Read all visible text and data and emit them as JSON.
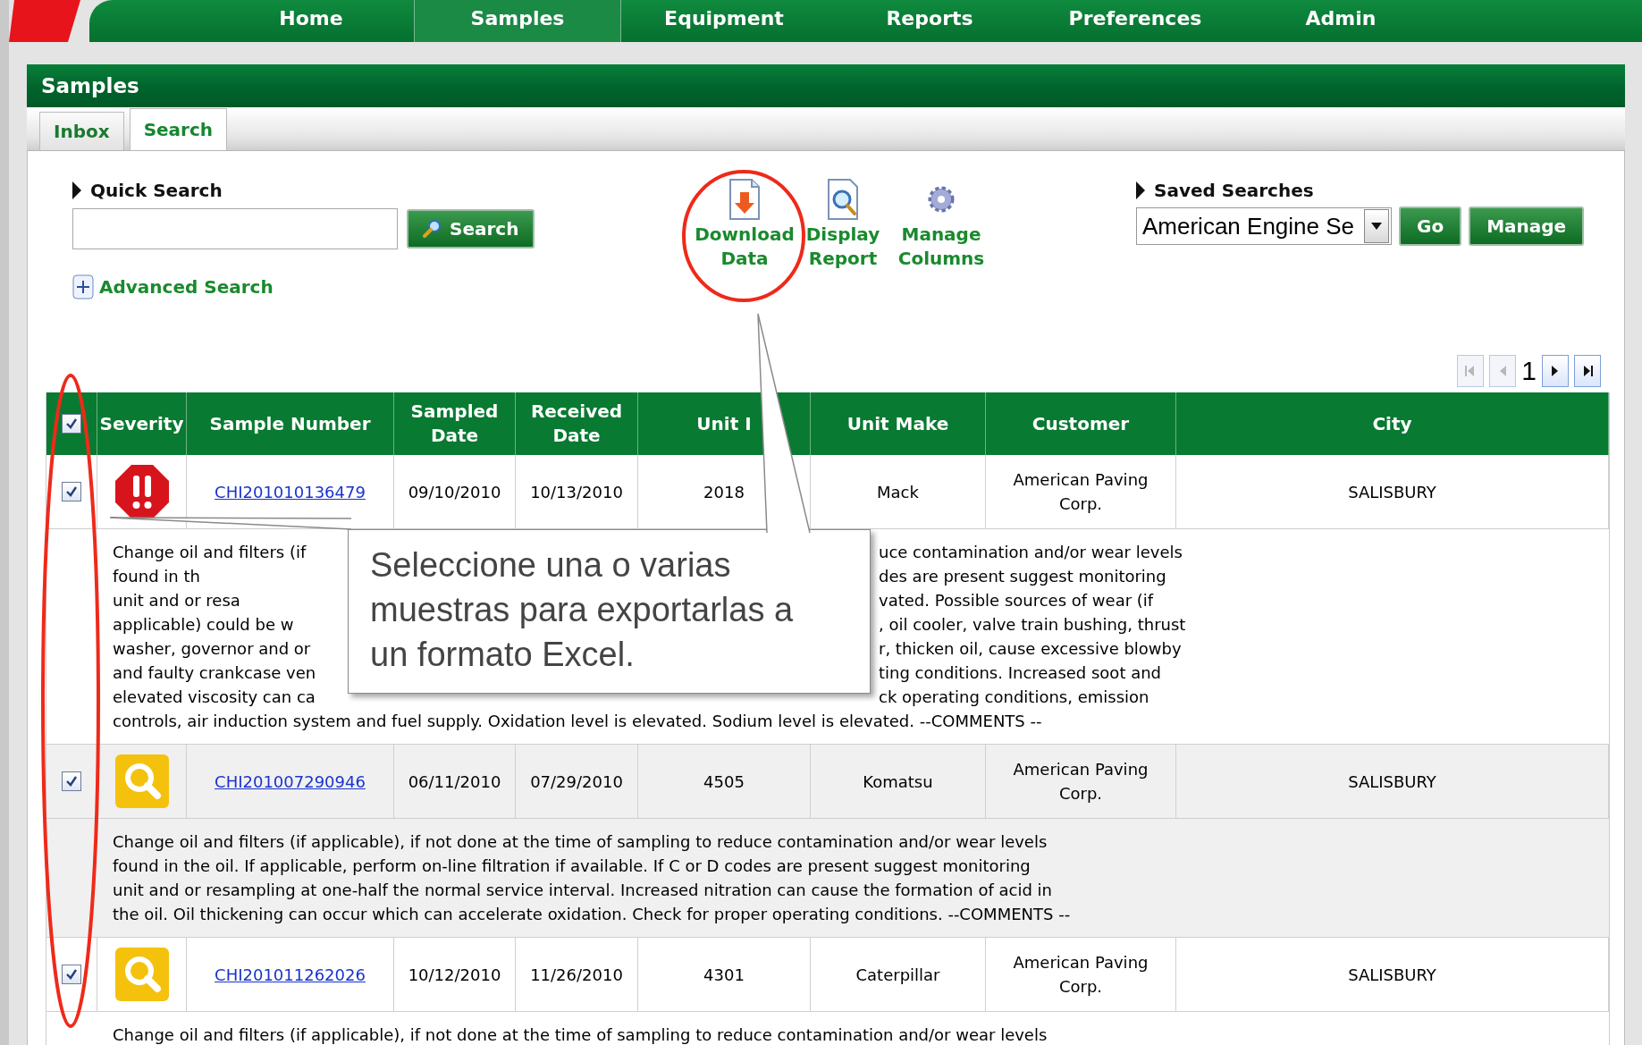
{
  "nav": [
    {
      "label": "Home",
      "selected": false
    },
    {
      "label": "Samples",
      "selected": true
    },
    {
      "label": "Equipment",
      "selected": false
    },
    {
      "label": "Reports",
      "selected": false
    },
    {
      "label": "Preferences",
      "selected": false
    },
    {
      "label": "Admin",
      "selected": false
    }
  ],
  "panel": {
    "title": "Samples"
  },
  "tabs": [
    {
      "label": "Inbox",
      "selected": false
    },
    {
      "label": "Search",
      "selected": true
    }
  ],
  "quick_search": {
    "label": "Quick Search",
    "button": "Search",
    "advanced": "Advanced Search"
  },
  "toolbar": [
    {
      "kind": "download",
      "lines": [
        "Download",
        "Data"
      ]
    },
    {
      "kind": "report",
      "lines": [
        "Display",
        "Report"
      ]
    },
    {
      "kind": "columns",
      "lines": [
        "Manage",
        "Columns"
      ]
    }
  ],
  "saved_searches": {
    "label": "Saved Searches",
    "value": "American Engine Se",
    "buttons": [
      "Go",
      "Manage"
    ]
  },
  "pager": {
    "page": "1",
    "buttons": [
      {
        "kind": "first",
        "disabled": true
      },
      {
        "kind": "prev",
        "disabled": true
      },
      {
        "kind": "next",
        "disabled": false
      },
      {
        "kind": "last",
        "disabled": false
      }
    ]
  },
  "table": {
    "select_all_checked": true,
    "columns": [
      "Severity",
      "Sample Number",
      "Sampled Date",
      "Received Date",
      "Unit I",
      "Unit Make",
      "Customer",
      "City"
    ],
    "rows": [
      {
        "checked": true,
        "kind": "critical",
        "sample": "CHI201010136479",
        "sampled": "09/10/2010",
        "received": "10/13/2010",
        "unit": "2018",
        "make": "Mack",
        "customer": "American Paving Corp.",
        "city": "SALISBURY",
        "shaded": false,
        "comment": [
          {
            "left": "Change oil and filters (if",
            "right": "uce contamination and/or wear levels"
          },
          {
            "left": "found in th",
            "right": "des are present suggest monitoring"
          },
          {
            "left": "unit and or resa",
            "right": "vated. Possible sources of wear (if"
          },
          {
            "left": "applicable) could be w",
            "right": ", oil cooler, valve train bushing, thrust"
          },
          {
            "left": "washer, governor and or",
            "right": "r, thicken oil, cause excessive blowby"
          },
          {
            "left": "and faulty crankcase ven",
            "right": "ting conditions. Increased soot and"
          },
          {
            "left": "elevated viscosity can ca",
            "right": "ck operating conditions, emission"
          },
          {
            "text": "controls, air induction system and fuel supply. Oxidation level is elevated. Sodium level is elevated. --COMMENTS --"
          }
        ]
      },
      {
        "checked": true,
        "kind": "caution",
        "sample": "CHI201007290946",
        "sampled": "06/11/2010",
        "received": "07/29/2010",
        "unit": "4505",
        "make": "Komatsu",
        "customer": "American Paving Corp.",
        "city": "SALISBURY",
        "shaded": true,
        "comment": [
          {
            "text": "Change oil and filters (if applicable), if not done at the time of sampling to reduce contamination and/or wear levels"
          },
          {
            "text": "found in the oil. If applicable, perform on-line filtration if available. If C or D codes are present suggest monitoring"
          },
          {
            "text": "unit and or resampling at one-half the normal service interval. Increased nitration can cause the formation of acid in"
          },
          {
            "text": "the oil. Oil thickening can occur which can accelerate oxidation. Check for proper operating conditions. --COMMENTS --"
          }
        ]
      },
      {
        "checked": true,
        "kind": "caution",
        "sample": "CHI201011262026",
        "sampled": "10/12/2010",
        "received": "11/26/2010",
        "unit": "4301",
        "make": "Caterpillar",
        "customer": "American Paving Corp.",
        "city": "SALISBURY",
        "shaded": false,
        "comment": [
          {
            "text": "Change oil and filters (if applicable), if not done at the time of sampling to reduce contamination and/or wear levels"
          }
        ]
      }
    ]
  },
  "callout": {
    "lines": [
      "Seleccione una o varias",
      "muestras para exportarlas a",
      "un formato Excel."
    ]
  }
}
